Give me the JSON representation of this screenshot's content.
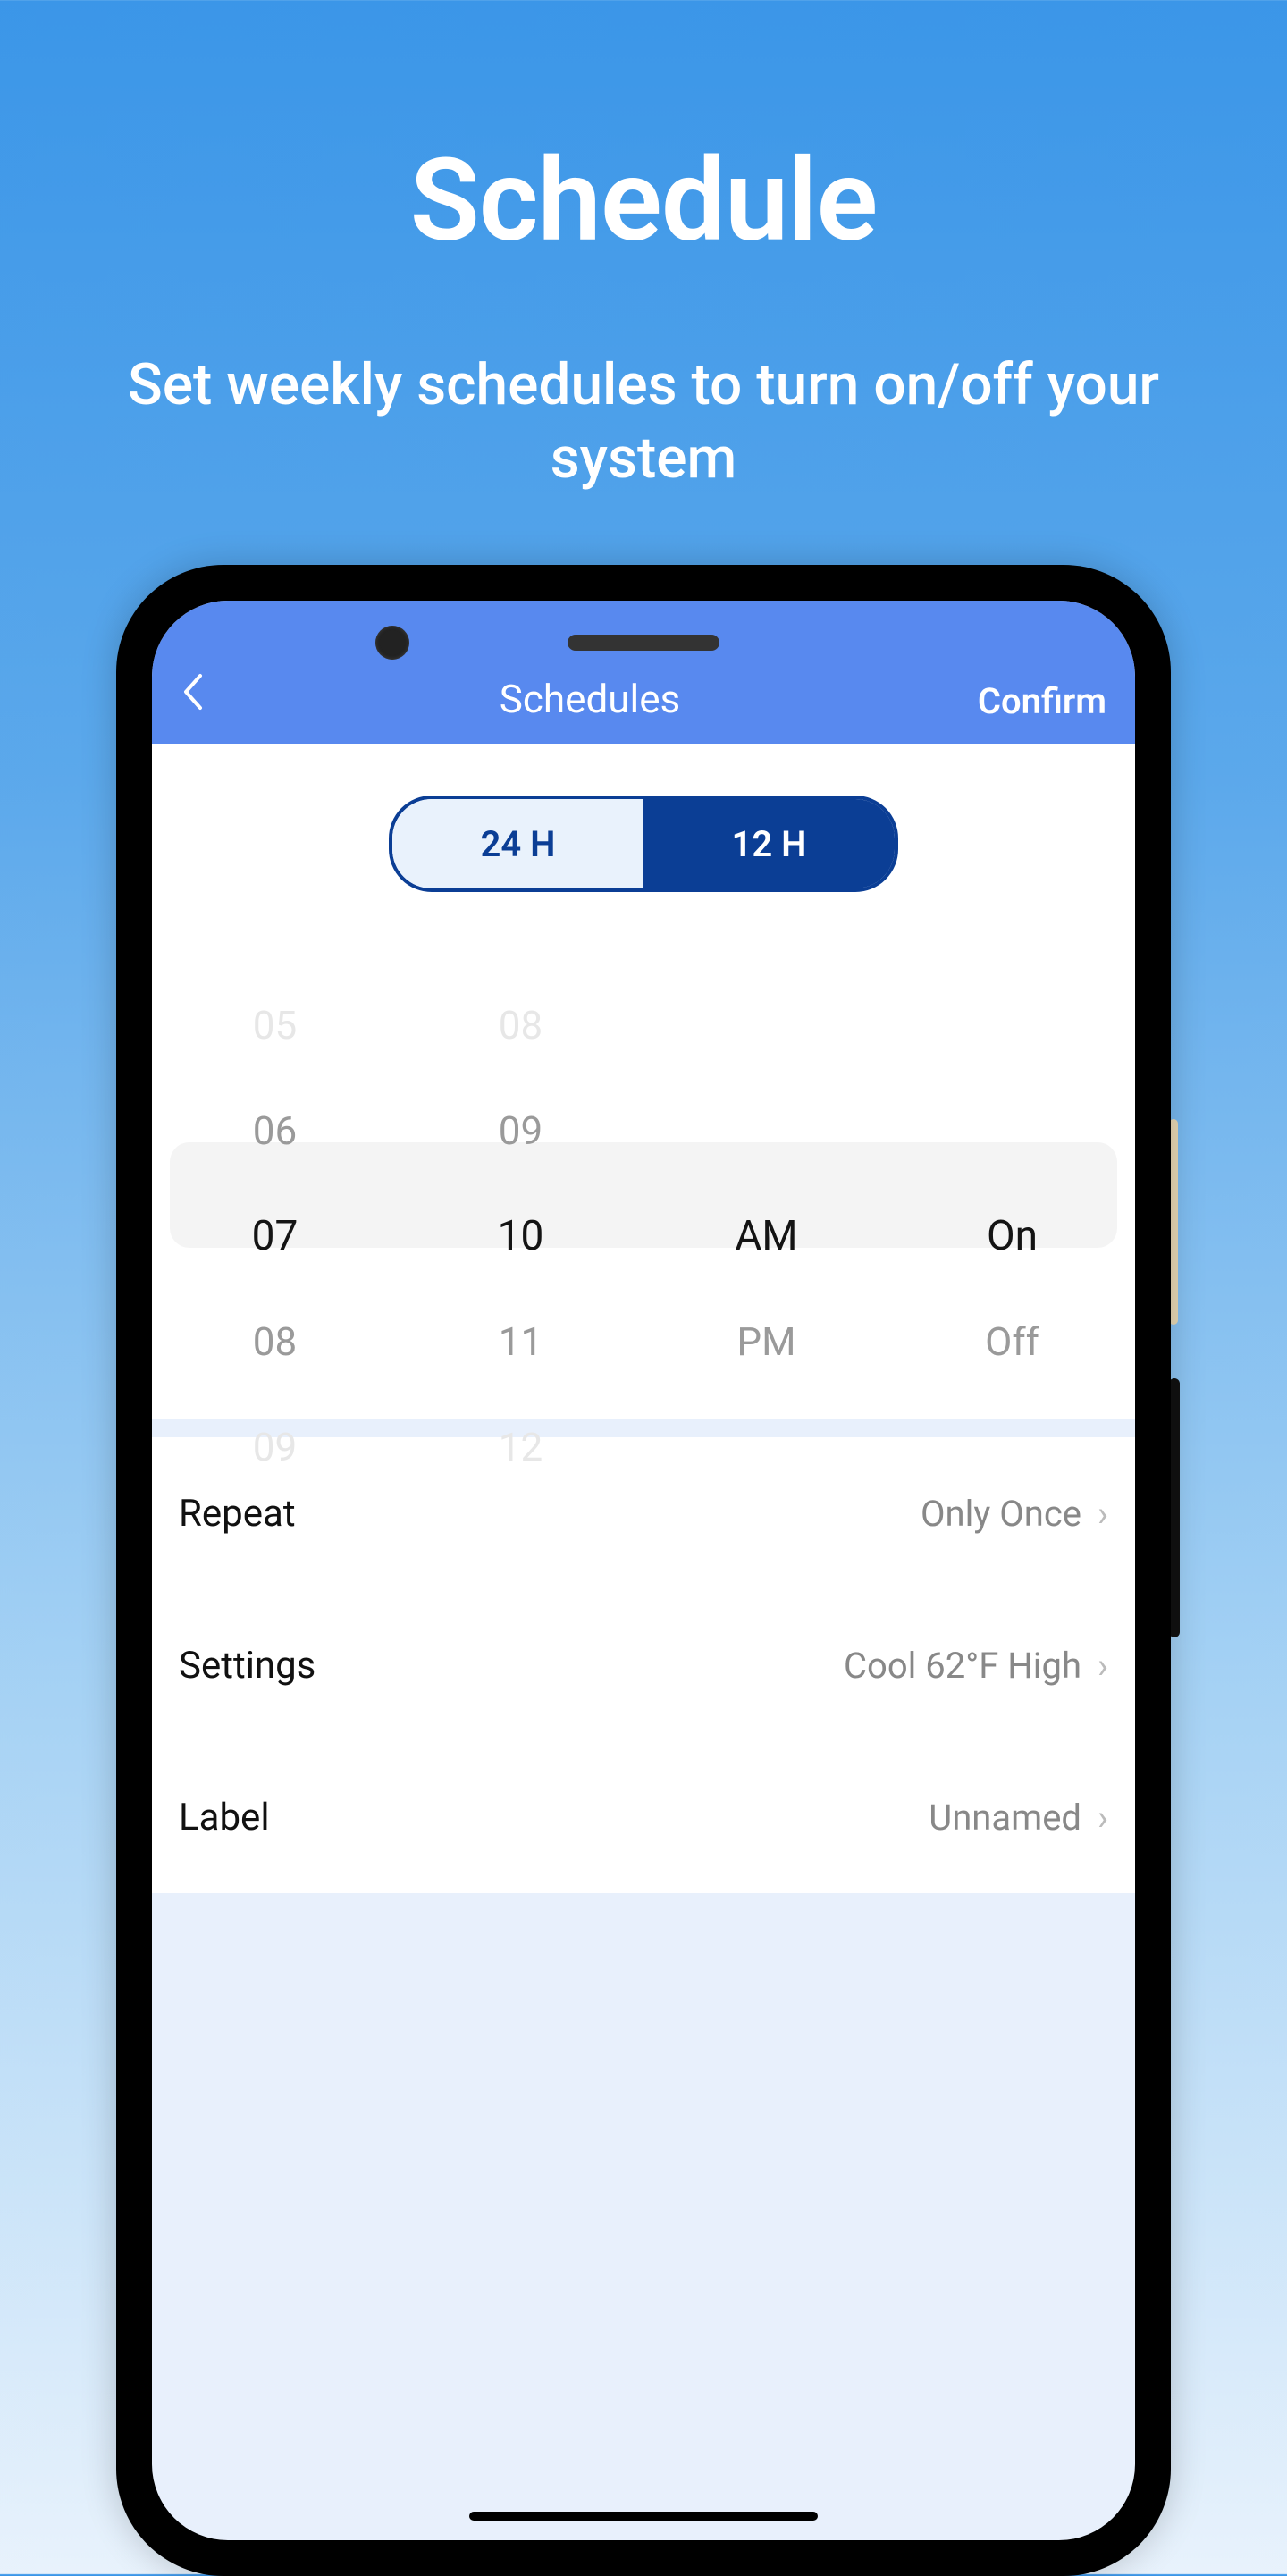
{
  "marketing": {
    "title": "Schedule",
    "subtitle": "Set weekly schedules to turn on/off your system"
  },
  "header": {
    "title": "Schedules",
    "confirm_label": "Confirm"
  },
  "segment": {
    "opt24": "24 H",
    "opt12": "12 H"
  },
  "picker": {
    "hour": {
      "m2": "05",
      "m1": "06",
      "sel": "07",
      "p1": "08",
      "p2": "09"
    },
    "min": {
      "m2": "08",
      "m1": "09",
      "sel": "10",
      "p1": "11",
      "p2": "12"
    },
    "ampm": {
      "sel": "AM",
      "p1": "PM"
    },
    "state": {
      "sel": "On",
      "p1": "Off"
    }
  },
  "rows": {
    "repeat": {
      "label": "Repeat",
      "value": "Only Once"
    },
    "settings": {
      "label": "Settings",
      "value": "Cool 62°F High"
    },
    "label": {
      "label": "Label",
      "value": "Unnamed"
    }
  }
}
